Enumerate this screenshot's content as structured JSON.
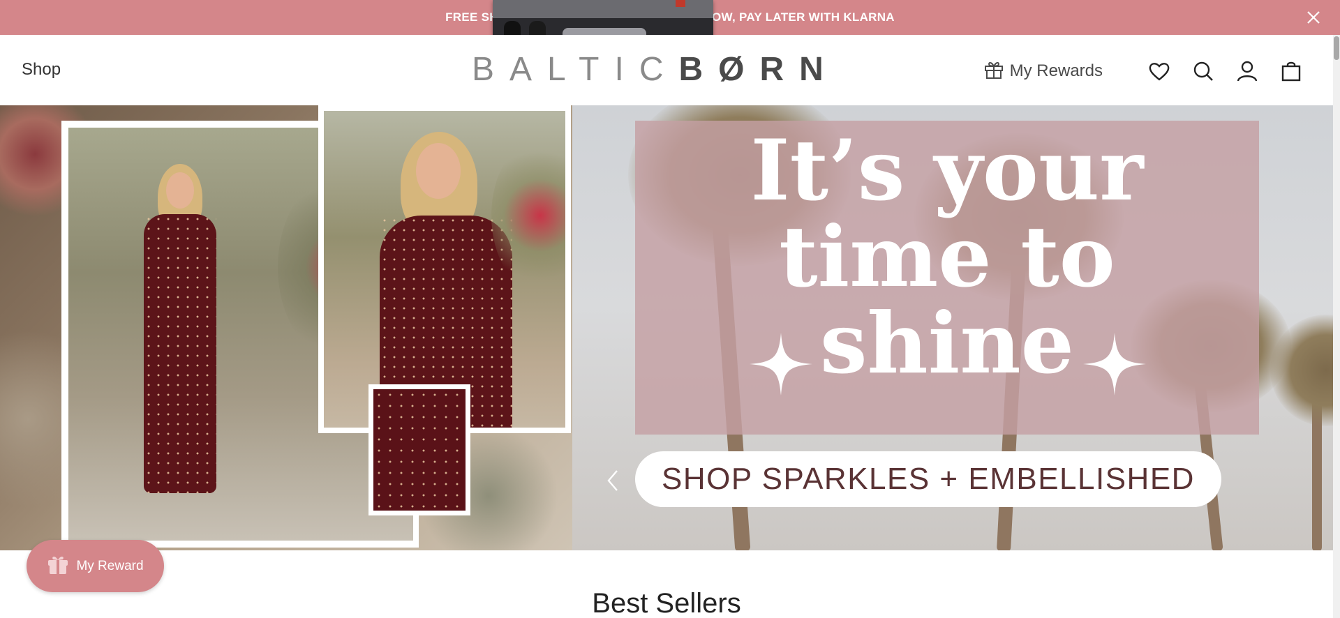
{
  "announcement": {
    "text": "FREE SHIPPING ON ORDERS $100+ | SHOP NOW, PAY LATER WITH KLARNA",
    "close_icon": "close-icon",
    "background": "#d4868a"
  },
  "header": {
    "shop_label": "Shop",
    "logo_light": "BALTIC",
    "logo_dark": "BØRN",
    "rewards_label": "My Rewards",
    "icons": [
      "gift-icon",
      "heart-icon",
      "search-icon",
      "account-icon",
      "bag-icon"
    ]
  },
  "hero": {
    "headline_line1": "It’s your",
    "headline_line2": "time to",
    "headline_line3": "shine",
    "cta_label": "SHOP SPARKLES + EMBELLISHED",
    "prev_icon": "chevron-left-icon",
    "accent": "#c4a0a4",
    "dress_color": "#5c1419"
  },
  "floating_reward": {
    "label": "My Reward",
    "icon": "gift-icon",
    "background": "#d4868a"
  },
  "sections": {
    "best_sellers_title": "Best Sellers"
  }
}
